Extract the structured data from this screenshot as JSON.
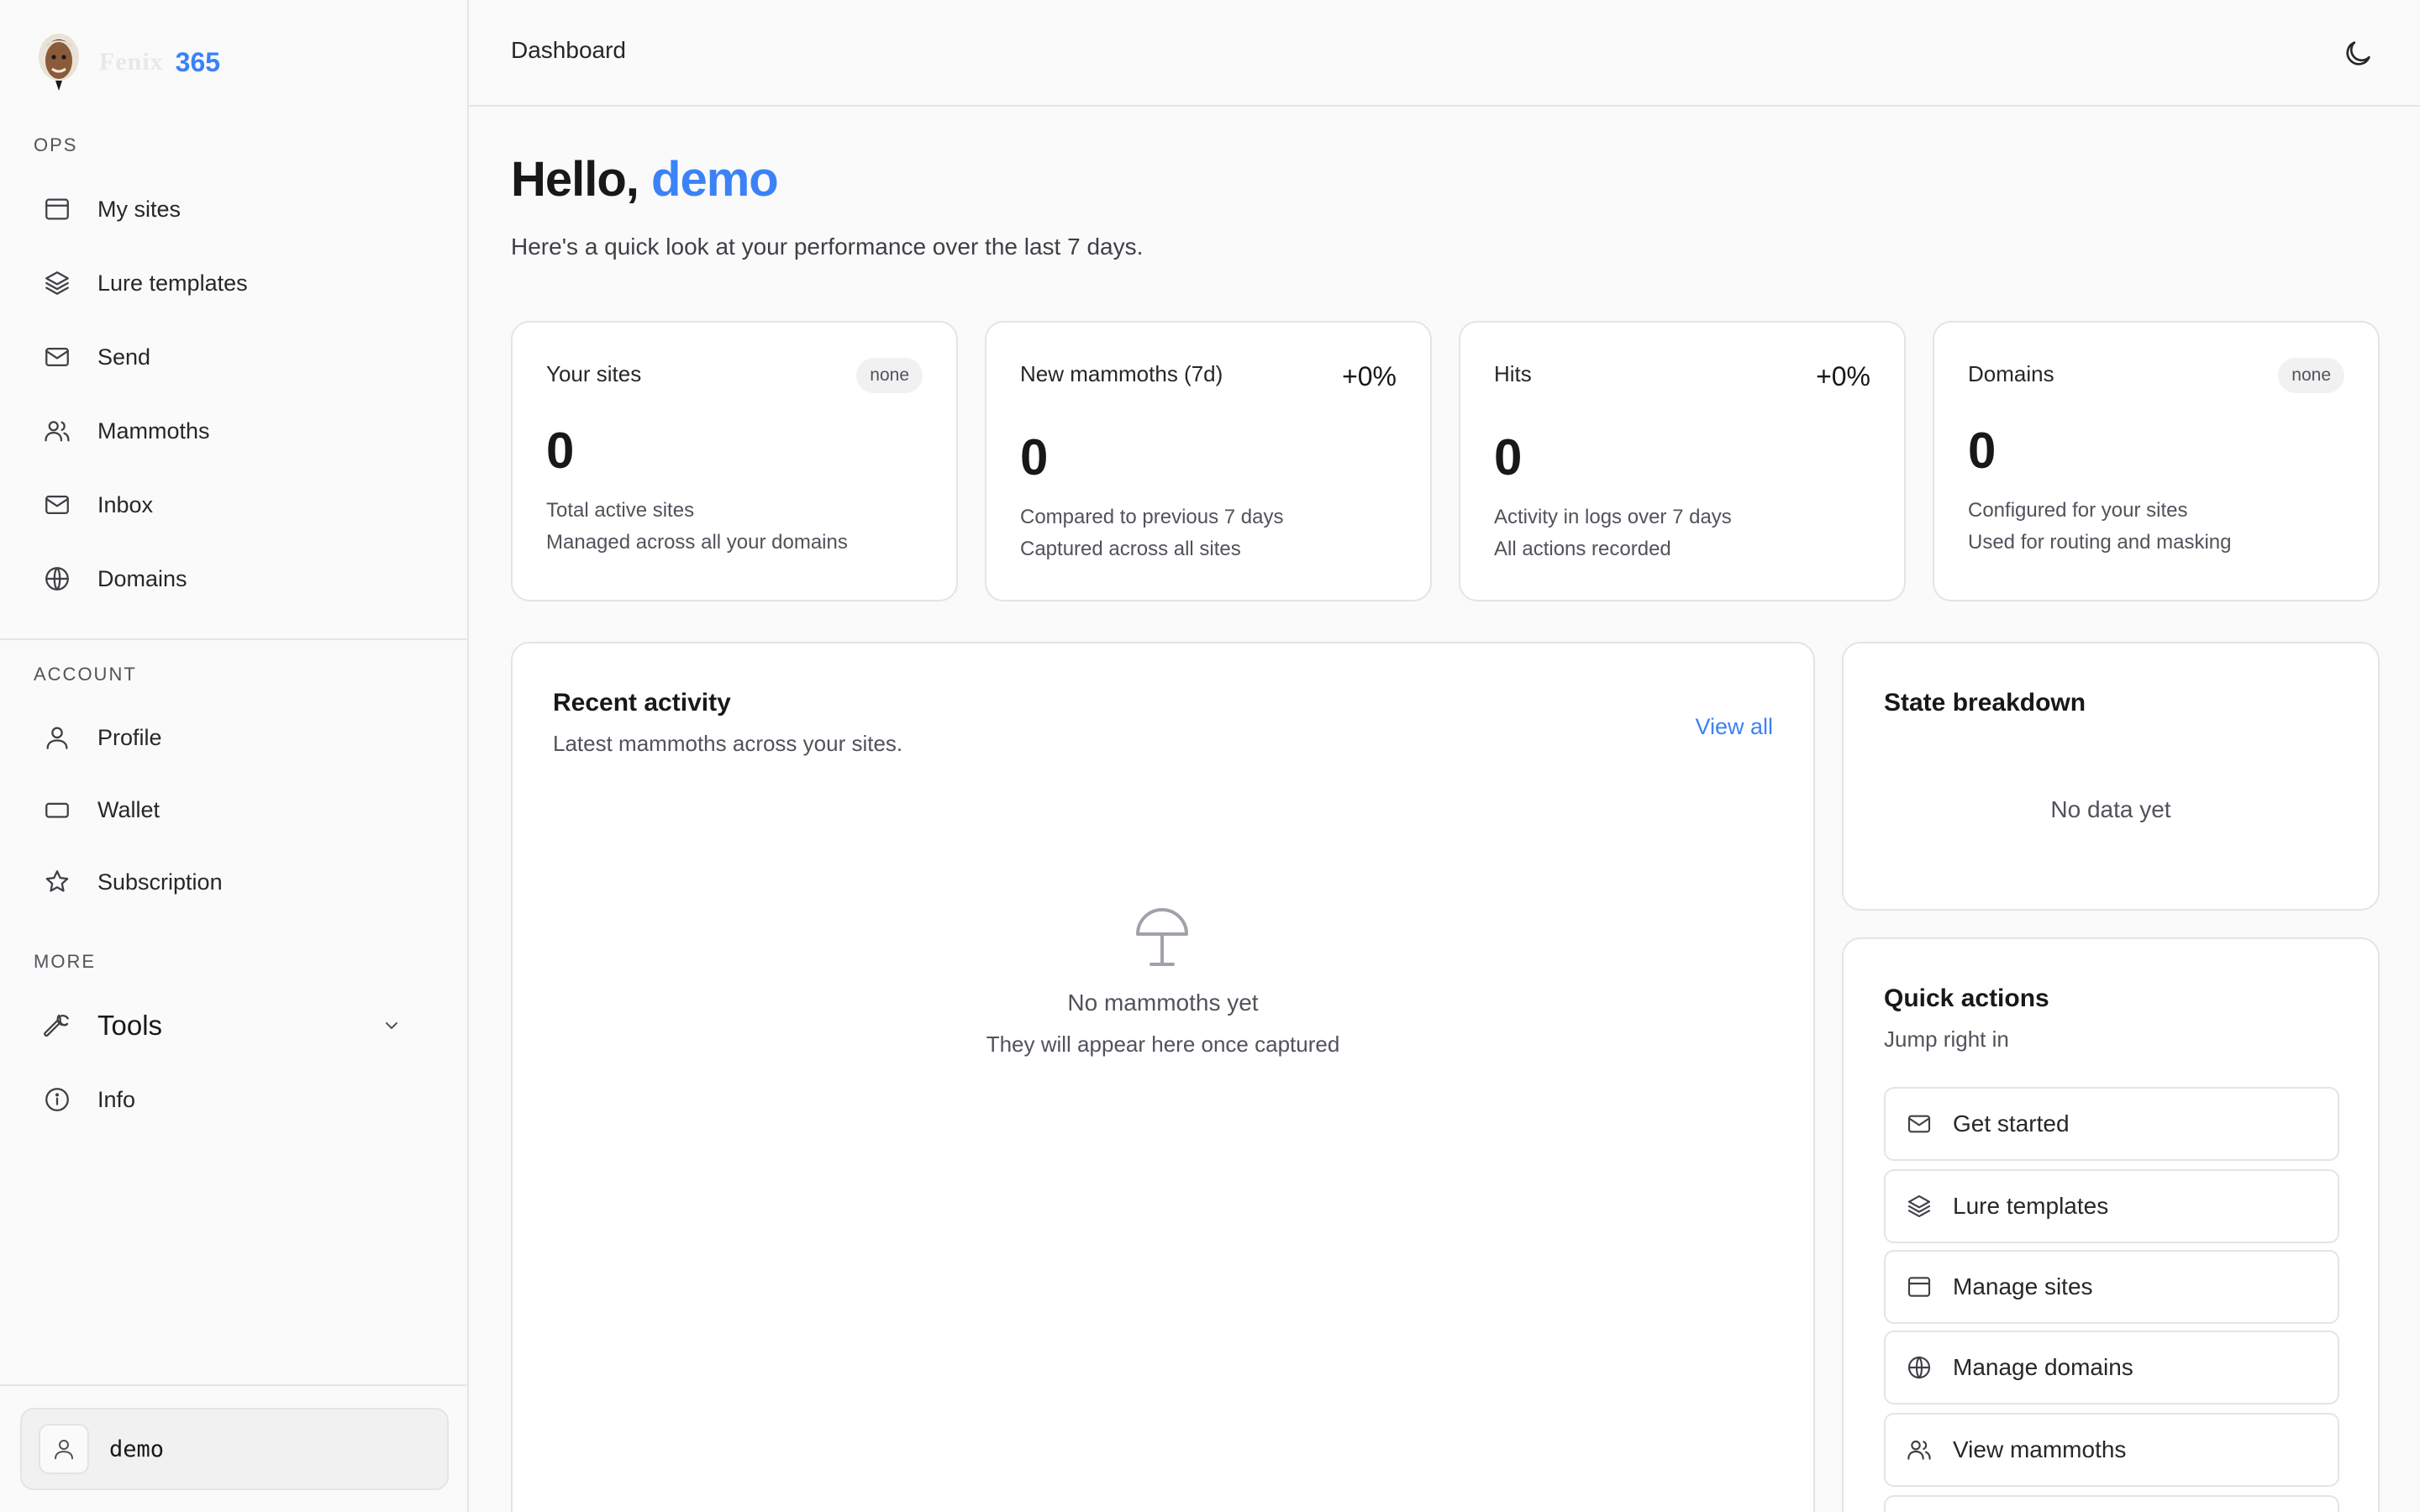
{
  "brand": {
    "name": "Fenix",
    "number": "365"
  },
  "sidebar": {
    "sections": {
      "ops": "OPS",
      "account": "ACCOUNT",
      "more": "MORE"
    },
    "ops_items": [
      {
        "label": "My sites",
        "icon": "browser-window-icon"
      },
      {
        "label": "Lure templates",
        "icon": "layers-icon"
      },
      {
        "label": "Send",
        "icon": "mail-icon"
      },
      {
        "label": "Mammoths",
        "icon": "users-icon"
      },
      {
        "label": "Inbox",
        "icon": "mail-icon"
      },
      {
        "label": "Domains",
        "icon": "globe-icon"
      }
    ],
    "account_items": [
      {
        "label": "Profile",
        "icon": "user-icon"
      },
      {
        "label": "Wallet",
        "icon": "wallet-icon"
      },
      {
        "label": "Subscription",
        "icon": "star-icon"
      }
    ],
    "more_items": [
      {
        "label": "Tools",
        "icon": "wrench-icon"
      },
      {
        "label": "Info",
        "icon": "info-icon"
      }
    ],
    "user": {
      "name": "demo"
    }
  },
  "header": {
    "breadcrumb": "Dashboard"
  },
  "main": {
    "greeting_prefix": "Hello,",
    "greeting_user": "demo",
    "subtitle": "Here's a quick look at your performance over the last 7 days.",
    "stats": [
      {
        "title": "Your sites",
        "badge": "none",
        "value": "0",
        "line1": "Total active sites",
        "line2": "Managed across all your domains"
      },
      {
        "title": "New mammoths (7d)",
        "delta": "+0%",
        "value": "0",
        "line1": "Compared to previous 7 days",
        "line2": "Captured across all sites"
      },
      {
        "title": "Hits",
        "delta": "+0%",
        "value": "0",
        "line1": "Activity in logs over 7 days",
        "line2": "All actions recorded"
      },
      {
        "title": "Domains",
        "badge": "none",
        "value": "0",
        "line1": "Configured for your sites",
        "line2": "Used for routing and masking"
      }
    ],
    "recent_activity": {
      "title": "Recent activity",
      "subtitle": "Latest mammoths across your sites.",
      "view_all": "View all",
      "empty_title": "No mammoths yet",
      "empty_sub": "They will appear here once captured"
    },
    "state_breakdown": {
      "title": "State breakdown",
      "empty": "No data yet"
    },
    "quick_actions": {
      "title": "Quick actions",
      "subtitle": "Jump right in",
      "items": [
        {
          "label": "Get started",
          "icon": "mail-icon"
        },
        {
          "label": "Lure templates",
          "icon": "layers-icon"
        },
        {
          "label": "Manage sites",
          "icon": "browser-window-icon"
        },
        {
          "label": "Manage domains",
          "icon": "globe-icon"
        },
        {
          "label": "View mammoths",
          "icon": "users-icon"
        }
      ]
    }
  },
  "colors": {
    "accent": "#3b82f6",
    "text": "#18181b",
    "muted": "#52525b",
    "border": "#e4e4e7",
    "background": "#fafafa"
  }
}
